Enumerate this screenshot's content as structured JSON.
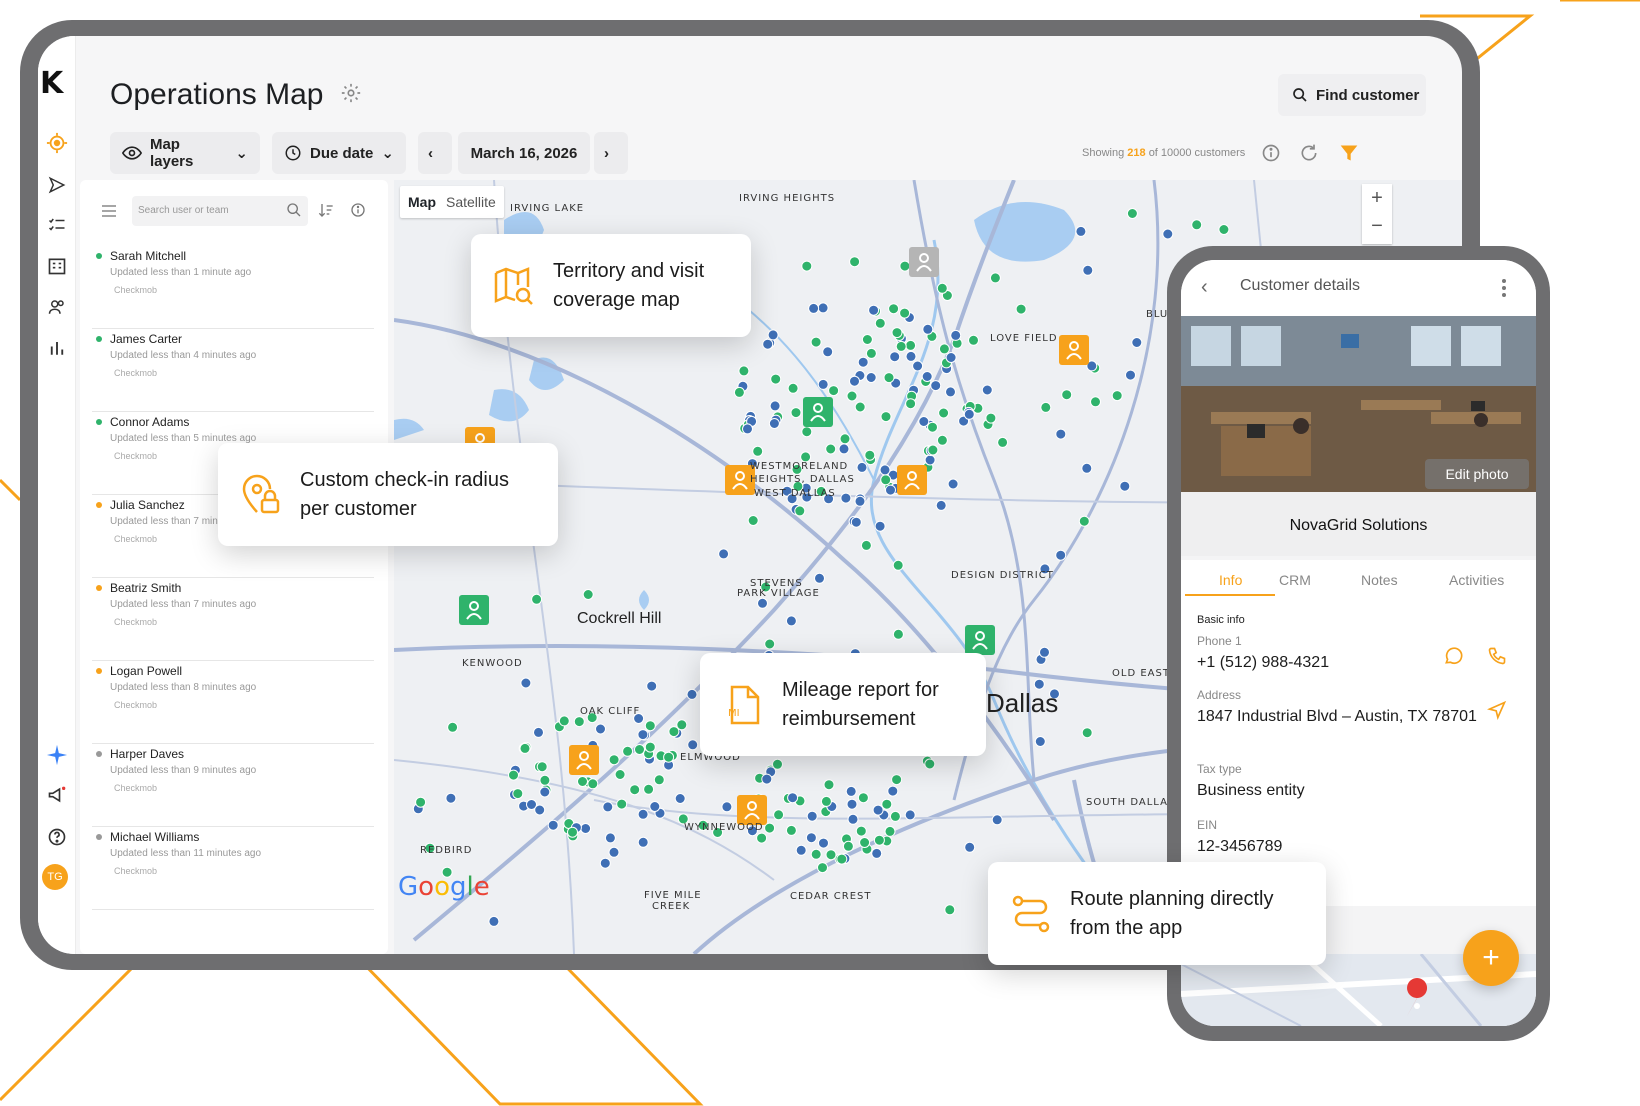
{
  "app": {
    "title": "Operations Map",
    "find_customer": "Find customer",
    "avatar_initials": "TG"
  },
  "toolbar": {
    "map_layers": "Map layers",
    "due_date": "Due date",
    "date": "March 16, 2026",
    "showing_prefix": "Showing",
    "showing_count": "218",
    "showing_suffix": "of 10000 customers"
  },
  "sidebar": {
    "search_placeholder": "Search user or team",
    "users": [
      {
        "name": "Sarah Mitchell",
        "status": "Updated less than 1 minute ago",
        "team": "Checkmob",
        "color": "#2fb36b"
      },
      {
        "name": "James Carter",
        "status": "Updated less than 4 minutes ago",
        "team": "Checkmob",
        "color": "#2fb36b"
      },
      {
        "name": "Connor Adams",
        "status": "Updated less than 5 minutes ago",
        "team": "Checkmob",
        "color": "#2fb36b"
      },
      {
        "name": "Julia Sanchez",
        "status": "Updated less than 7 minutes ago",
        "team": "Checkmob",
        "color": "#f7a21b"
      },
      {
        "name": "Beatriz Smith",
        "status": "Updated less than 7 minutes ago",
        "team": "Checkmob",
        "color": "#f7a21b"
      },
      {
        "name": "Logan Powell",
        "status": "Updated less than 8 minutes ago",
        "team": "Checkmob",
        "color": "#f7a21b"
      },
      {
        "name": "Harper Daves",
        "status": "Updated less than 9 minutes ago",
        "team": "Checkmob",
        "color": "#999999"
      },
      {
        "name": "Michael Williams",
        "status": "Updated less than 11 minutes ago",
        "team": "Checkmob",
        "color": "#999999"
      }
    ]
  },
  "map": {
    "tab_map": "Map",
    "tab_satellite": "Satellite",
    "labels": [
      "IRVING LAKE",
      "IRVING HEIGHTS",
      "LOVE FIELD",
      "WESTMORELAND",
      "HEIGHTS, DALLAS",
      "WEST DALLAS",
      "STEVENS",
      "PARK VILLAGE",
      "DESIGN DISTRICT",
      "KENWOOD",
      "OAK CLIFF",
      "ELMWOOD",
      "WYNNEWOOD",
      "REDBIRD",
      "FIVE MILE",
      "CREEK",
      "CEDAR CREST",
      "SOUTH DALLAS",
      "OLD EAST",
      "BLU"
    ],
    "city_cockrell": "Cockrell Hill",
    "city_dallas": "Dallas",
    "google": "Google"
  },
  "callouts": {
    "territory": "Territory and visit\ncoverage map",
    "checkin": "Custom check-in radius\nper customer",
    "mileage": "Mileage report for\nreimbursement",
    "route": "Route planning directly\nfrom the app"
  },
  "phone": {
    "header": "Customer details",
    "edit_photo": "Edit photo",
    "company": "NovaGrid Solutions",
    "tabs": [
      "Info",
      "CRM",
      "Notes",
      "Activities"
    ],
    "basic_info": "Basic info",
    "phone_label": "Phone 1",
    "phone_value": "+1 (512) 988-4321",
    "address_label": "Address",
    "address_value": "1847 Industrial Blvd – Austin, TX 78701",
    "tax_label": "Tax type",
    "tax_value": "Business entity",
    "ein_label": "EIN",
    "ein_value": "12-3456789"
  },
  "colors": {
    "accent": "#f7a21b",
    "pin_green": "#2fb36b",
    "pin_blue": "#3f6fb5"
  }
}
